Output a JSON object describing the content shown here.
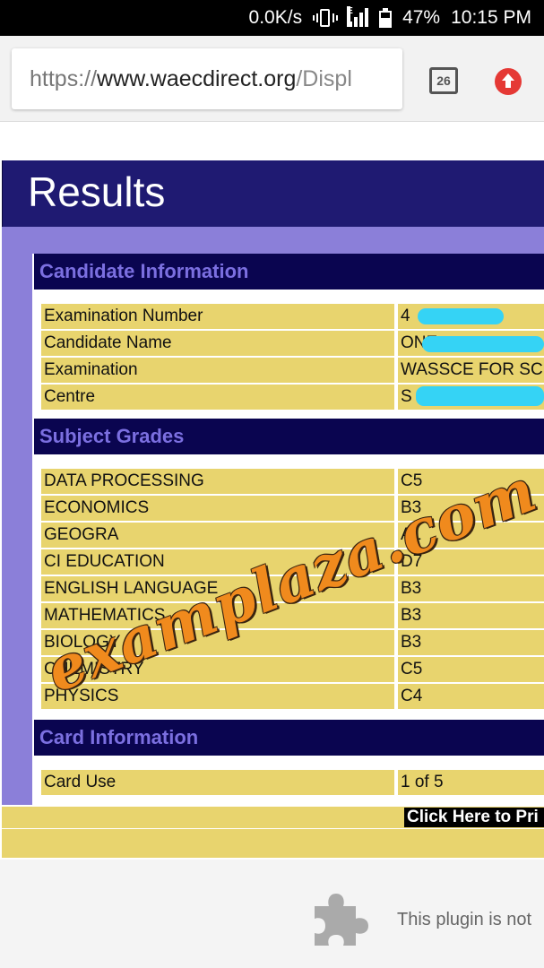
{
  "status_bar": {
    "speed": "0.0K/s",
    "network_letter": "E",
    "battery": "47%",
    "time": "10:15 PM"
  },
  "browser": {
    "url_scheme": "https://",
    "url_host": "www.waecdirect.org",
    "url_path": "/Displ",
    "tab_count": "26"
  },
  "page": {
    "title": "Results",
    "candidate_section": {
      "heading": "Candidate Information",
      "rows": [
        {
          "label": "Examination Number",
          "value": "4"
        },
        {
          "label": "Candidate Name",
          "value": "ONE"
        },
        {
          "label": "Examination",
          "value": "WASSCE FOR SCH"
        },
        {
          "label": "Centre",
          "value": "S"
        }
      ]
    },
    "grades_section": {
      "heading": "Subject Grades",
      "rows": [
        {
          "label": "DATA PROCESSING",
          "value": "C5"
        },
        {
          "label": "ECONOMICS",
          "value": "B3"
        },
        {
          "label": "GEOGRA",
          "value": "A1"
        },
        {
          "label": "CI   EDUCATION",
          "value": "D7"
        },
        {
          "label": "ENGLISH LANGUAGE",
          "value": "B3"
        },
        {
          "label": "MATHEMATICS",
          "value": "B3"
        },
        {
          "label": "BIOLOGY",
          "value": "B3"
        },
        {
          "label": "CHEMISTRY",
          "value": "C5"
        },
        {
          "label": "PHYSICS",
          "value": "C4"
        }
      ]
    },
    "card_section": {
      "heading": "Card Information",
      "rows": [
        {
          "label": "Card Use",
          "value": "1 of 5"
        }
      ]
    },
    "print_link": "Click Here to Pri",
    "plugin_message": "This plugin is not",
    "watermark": "examplaza.com"
  },
  "colors": {
    "header_bg": "#1f1a72",
    "frame_purple": "#8b7fd9",
    "section_bg": "#0a0550",
    "section_text": "#7b6fe0",
    "row_yellow": "#e8d46e",
    "redaction": "#35d3f5",
    "watermark": "#f08a1d"
  }
}
